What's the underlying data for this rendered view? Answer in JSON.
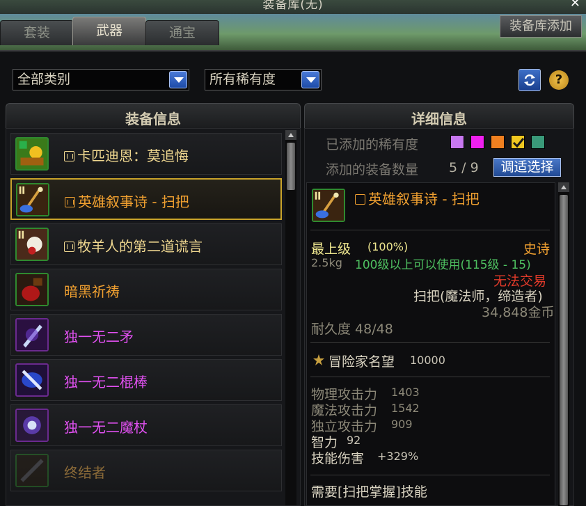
{
  "window": {
    "title": "装备库(无)",
    "close_glyph": "✕"
  },
  "tabs": [
    {
      "label": "套装",
      "active": false
    },
    {
      "label": "武器",
      "active": true
    },
    {
      "label": "通宝",
      "active": false
    }
  ],
  "add_button_label": "装备库添加",
  "filters": {
    "category": "全部类别",
    "rarity": "所有稀有度"
  },
  "toolbar": {
    "refresh_icon": "refresh-icon",
    "help_glyph": "?"
  },
  "left_panel": {
    "header": "装备信息",
    "items": [
      {
        "name": "卡匹迪恩：莫追悔",
        "has_mark": true,
        "color": "#f0d890",
        "icon": "green-burst-icon",
        "selected": false
      },
      {
        "name": "英雄叙事诗 - 扫把",
        "has_mark": true,
        "color": "#f0a030",
        "icon": "broom-icon",
        "selected": true
      },
      {
        "name": "牧羊人的第二道谎言",
        "has_mark": true,
        "color": "#f0d890",
        "icon": "sheep-icon",
        "selected": false
      },
      {
        "name": "暗黑祈祷",
        "has_mark": false,
        "color": "#f0a030",
        "icon": "dark-prayer-icon",
        "selected": false
      },
      {
        "name": "独一无二矛",
        "has_mark": false,
        "color": "#e050f0",
        "icon": "spear-icon",
        "selected": false
      },
      {
        "name": "独一无二棍棒",
        "has_mark": false,
        "color": "#e050f0",
        "icon": "rod-icon",
        "selected": false
      },
      {
        "name": "独一无二魔杖",
        "has_mark": false,
        "color": "#e050f0",
        "icon": "wand-icon",
        "selected": false
      },
      {
        "name": "终结者",
        "has_mark": false,
        "color": "#8a6a38",
        "icon": "terminator-icon",
        "selected": false
      }
    ]
  },
  "right_panel": {
    "header": "详细信息",
    "added_rarity_label": "已添加的稀有度",
    "rarity_swatches": [
      "#c878f0",
      "#f020f0",
      "#f08020",
      "#f0c820",
      "#3a9a7a"
    ],
    "added_count_label": "添加的装备数量",
    "added_count": "5 / 9",
    "choose_button": "调适选择",
    "detail": {
      "name": "英雄叙事诗 - 扫把",
      "grade": "最上级",
      "grade_percent": "(100%)",
      "rarity": "史诗",
      "weight": "2.5kg",
      "level_req": "100级以上可以使用(115级 - 15)",
      "trade": "无法交易",
      "type": "扫把(魔法师，缔造者)",
      "price": "34,848金币",
      "durability": "耐久度 48/48",
      "fame_label": "冒险家名望",
      "fame_value": "10000",
      "stats": [
        {
          "label": "物理攻击力",
          "value": "1403"
        },
        {
          "label": "魔法攻击力",
          "value": "1542"
        },
        {
          "label": "独立攻击力",
          "value": "909"
        },
        {
          "label": "智力",
          "value": "92"
        },
        {
          "label": "技能伤害",
          "value": "+329%"
        }
      ],
      "skill_req": "需要[扫把掌握]技能"
    }
  }
}
